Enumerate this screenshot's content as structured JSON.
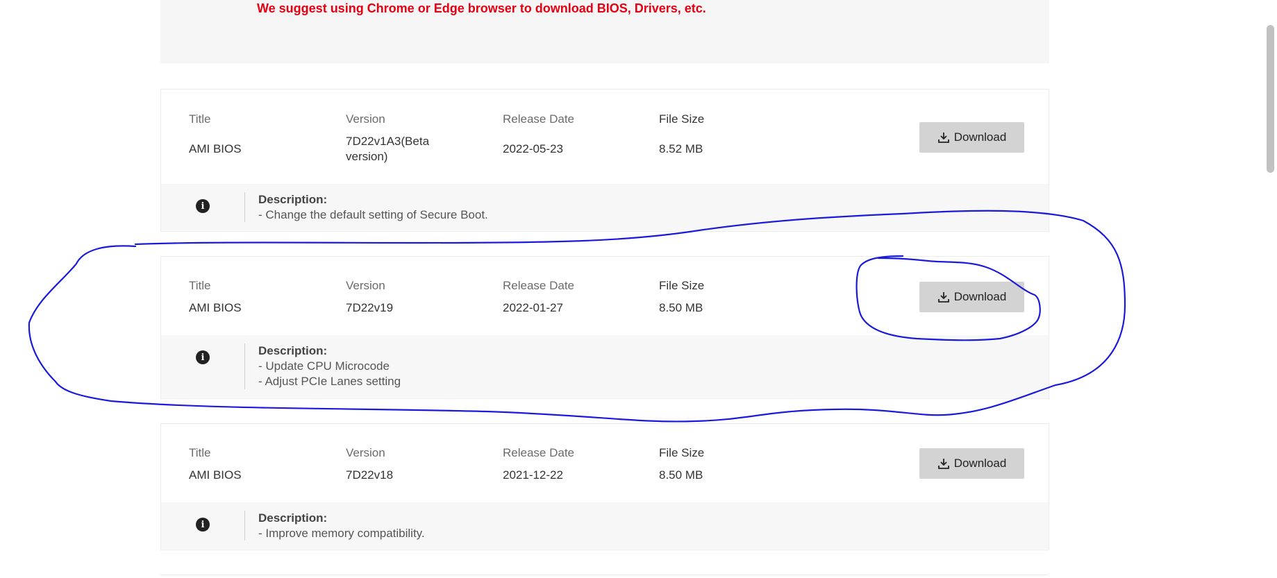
{
  "notice": "We suggest using Chrome or Edge browser to download BIOS, Drivers, etc.",
  "headers": {
    "title": "Title",
    "version": "Version",
    "release_date": "Release Date",
    "file_size": "File Size"
  },
  "download_label": "Download",
  "description_label": "Description:",
  "entries": [
    {
      "title": "AMI BIOS",
      "version_line1": "7D22v1A3(Beta",
      "version_line2": "version)",
      "release_date": "2022-05-23",
      "file_size": "8.52 MB",
      "desc_lines": [
        "- Change the default setting of Secure Boot."
      ]
    },
    {
      "title": "AMI BIOS",
      "version_line1": "7D22v19",
      "version_line2": "",
      "release_date": "2022-01-27",
      "file_size": "8.50 MB",
      "desc_lines": [
        "- Update CPU Microcode",
        "- Adjust PCIe Lanes setting"
      ]
    },
    {
      "title": "AMI BIOS",
      "version_line1": "7D22v18",
      "version_line2": "",
      "release_date": "2021-12-22",
      "file_size": "8.50 MB",
      "desc_lines": [
        "- Improve memory compatibility."
      ]
    }
  ],
  "annotation_color": "#1a1adb",
  "notice_color": "#e60012",
  "icons": {
    "download": "download-icon",
    "info": "info-icon"
  }
}
